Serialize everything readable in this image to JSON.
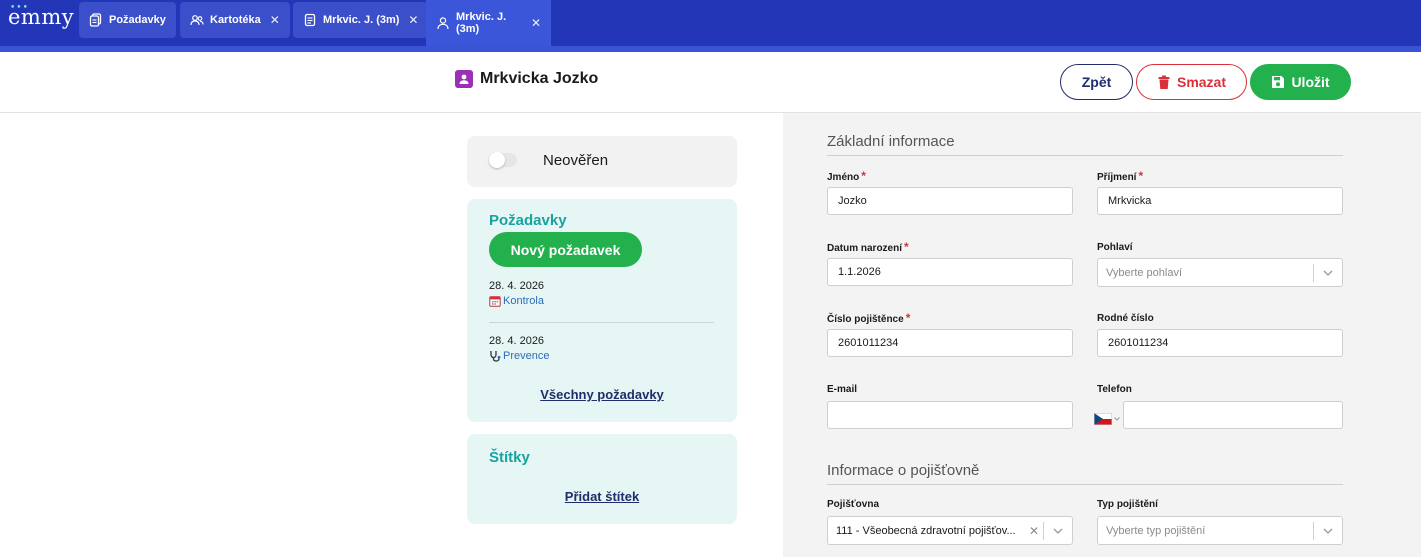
{
  "app": {
    "logo_text": "emmy",
    "logo_dots": "•••"
  },
  "tabs": [
    {
      "label": "Požadavky",
      "icon": "document-copy-icon",
      "closable": false
    },
    {
      "label": "Kartotéka",
      "icon": "users-icon",
      "closable": true
    },
    {
      "label": "Mrkvic. J. (3m)",
      "icon": "document-icon",
      "closable": true
    },
    {
      "label": "Mrkvic. J. (3m)",
      "icon": "user-icon",
      "closable": true,
      "active": true
    }
  ],
  "tab_close_glyph": "✕",
  "header": {
    "title": "Mrkvicka Jozko",
    "back_label": "Zpět",
    "delete_label": "Smazat",
    "save_label": "Uložit"
  },
  "status_card": {
    "label": "Neověřen",
    "verified": false
  },
  "requests_card": {
    "heading": "Požadavky",
    "new_button": "Nový požadavek",
    "items": [
      {
        "date": "28. 4. 2026",
        "type": "Kontrola",
        "icon": "calendar-icon"
      },
      {
        "date": "28. 4. 2026",
        "type": "Prevence",
        "icon": "stethoscope-icon"
      }
    ],
    "all_link": "Všechny požadavky"
  },
  "tags_card": {
    "heading": "Štítky",
    "add_link": "Přidat štítek"
  },
  "form": {
    "basic_section": "Základní informace",
    "first_name": {
      "label": "Jméno",
      "value": "Jozko",
      "required": true
    },
    "last_name": {
      "label": "Příjmení",
      "value": "Mrkvicka",
      "required": true
    },
    "birth_date": {
      "label": "Datum narození",
      "value": "1.1.2026",
      "required": true
    },
    "gender": {
      "label": "Pohlaví",
      "placeholder": "Vyberte pohlaví"
    },
    "insurance_number": {
      "label": "Číslo pojištěnce",
      "value": "2601011234",
      "required": true
    },
    "birth_number": {
      "label": "Rodné číslo",
      "value": "2601011234"
    },
    "email": {
      "label": "E-mail",
      "value": ""
    },
    "phone": {
      "label": "Telefon",
      "value": "",
      "country": "CZ"
    },
    "insurance_section": "Informace o pojišťovně",
    "insurer": {
      "label": "Pojišťovna",
      "value": "111 - Všeobecná zdravotní pojišťov..."
    },
    "insurance_type": {
      "label": "Typ pojištění",
      "placeholder": "Vyberte typ pojištění"
    },
    "required_mark": "*"
  },
  "colors": {
    "topbar": "#2336b8",
    "active_tab": "#3b56d8",
    "green": "#22b14c",
    "red": "#d9303a",
    "navy": "#1f2d6b",
    "teal": "#17a3a0",
    "card_bg": "#e6f6f5"
  }
}
